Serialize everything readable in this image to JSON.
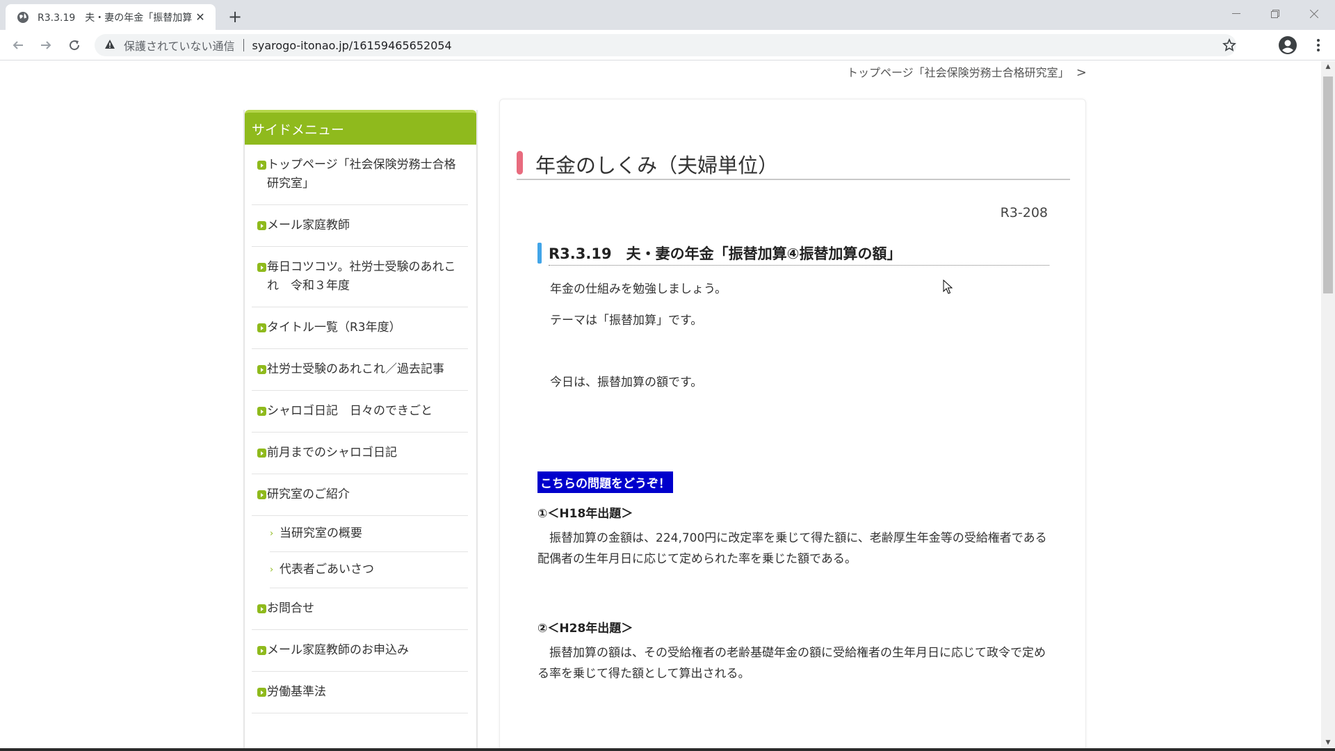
{
  "browser": {
    "tab_title": "R3.3.19　夫・妻の年金「振替加算",
    "security_label": "保護されていない通信",
    "url": "syarogo-itonao.jp/16159465652054"
  },
  "page": {
    "breadcrumb": "トップページ「社会保険労務士合格研究室」",
    "breadcrumb_arrow": ">",
    "sidebar": {
      "heading": "サイドメニュー",
      "items": [
        "トップページ「社会保険労務士合格研究室」",
        "メール家庭教師",
        "毎日コツコツ。社労士受験のあれこれ　令和３年度",
        "タイトル一覧（R3年度）",
        "社労士受験のあれこれ／過去記事",
        "シャロゴ日記　日々のできごと",
        "前月までのシャロゴ日記",
        "研究室のご紹介"
      ],
      "subitems": [
        "当研究室の概要",
        "代表者ごあいさつ"
      ],
      "items_after": [
        "お問合せ",
        "メール家庭教師のお申込み",
        "労働基準法"
      ]
    },
    "main": {
      "title": "年金のしくみ（夫婦単位）",
      "code": "R3-208",
      "subheading": "R3.3.19　夫・妻の年金「振替加算④振替加算の額」",
      "intro1": "年金の仕組みを勉強しましょう。",
      "intro2": "テーマは「振替加算」です。",
      "intro3": "今日は、振替加算の額です。",
      "cta": "こちらの問題をどうぞ！",
      "questions": [
        {
          "heading": "①＜H18年出題＞",
          "body": "振替加算の金額は、224,700円に改定率を乗じて得た額に、老齢厚生年金等の受給権者である配偶者の生年月日に応じて定められた率を乗じた額である。"
        },
        {
          "heading": "②＜H28年出題＞",
          "body": "振替加算の額は、その受給権者の老齢基礎年金の額に受給権者の生年月日に応じて政令で定める率を乗じて得た額として算出される。"
        }
      ]
    }
  },
  "colors": {
    "sidebar_green": "#8fba1d",
    "title_mark_pink": "#e86b7e",
    "subhead_mark_blue": "#42a5e8",
    "cta_blue": "#0000cc"
  }
}
